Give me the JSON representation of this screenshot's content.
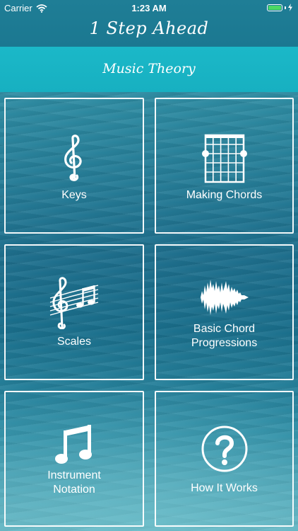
{
  "status_bar": {
    "carrier": "Carrier",
    "time": "1:23 AM",
    "battery_level": 1.0,
    "icons": [
      "wifi-icon",
      "battery-icon",
      "charging-icon"
    ]
  },
  "header": {
    "title": "1 Step Ahead"
  },
  "section": {
    "title": "Music Theory"
  },
  "tiles": [
    {
      "label": "Keys",
      "icon": "treble-clef-icon"
    },
    {
      "label": "Making Chords",
      "icon": "guitar-chord-diagram-icon"
    },
    {
      "label": "Scales",
      "icon": "music-staff-icon"
    },
    {
      "label": "Basic Chord\nProgressions",
      "icon": "waveform-icon"
    },
    {
      "label": "Instrument\nNotation",
      "icon": "music-note-icon"
    },
    {
      "label": "How It Works",
      "icon": "question-circle-icon"
    }
  ],
  "colors": {
    "header_bg": "#1f7e96",
    "section_bar_bg": "#1bb8c8",
    "battery_fill": "#4cd964",
    "text": "#ffffff"
  }
}
